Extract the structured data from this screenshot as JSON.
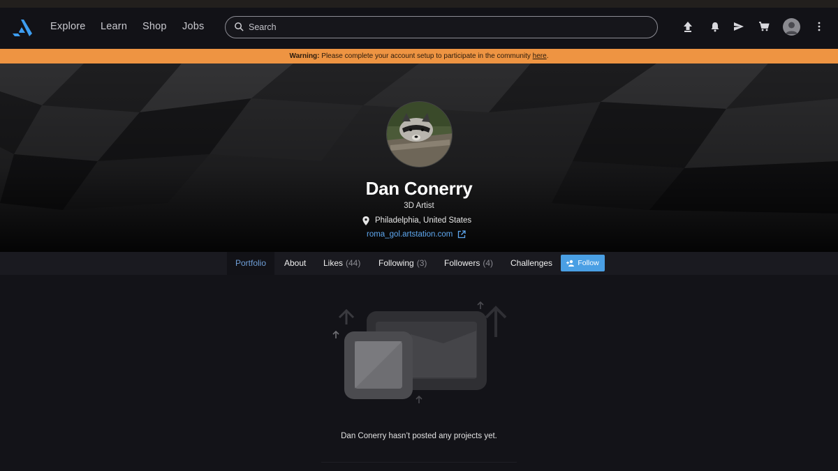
{
  "nav": {
    "links": [
      "Explore",
      "Learn",
      "Shop",
      "Jobs"
    ],
    "search_placeholder": "Search",
    "icons": [
      "upload-icon",
      "bell-icon",
      "send-icon",
      "cart-icon",
      "avatar",
      "more-vertical-icon"
    ]
  },
  "warning": {
    "label": "Warning:",
    "text": " Please complete your account setup to participate in the community ",
    "link": "here",
    "end": "."
  },
  "profile": {
    "name": "Dan Conerry",
    "title": "3D Artist",
    "location": "Philadelphia, United States",
    "website": "roma_gol.artstation.com"
  },
  "tabs": [
    {
      "label": "Portfolio",
      "count": ""
    },
    {
      "label": "About",
      "count": ""
    },
    {
      "label": "Likes",
      "count": "(44)"
    },
    {
      "label": "Following",
      "count": "(3)"
    },
    {
      "label": "Followers",
      "count": "(4)"
    },
    {
      "label": "Challenges",
      "count": ""
    }
  ],
  "follow_label": "Follow",
  "empty_message": "Dan Conerry hasn’t posted any projects yet.",
  "colors": {
    "accent": "#4a9fe4",
    "warning": "#ee9442",
    "active_tab": "#6f9fd8",
    "link": "#5ea7ef"
  }
}
